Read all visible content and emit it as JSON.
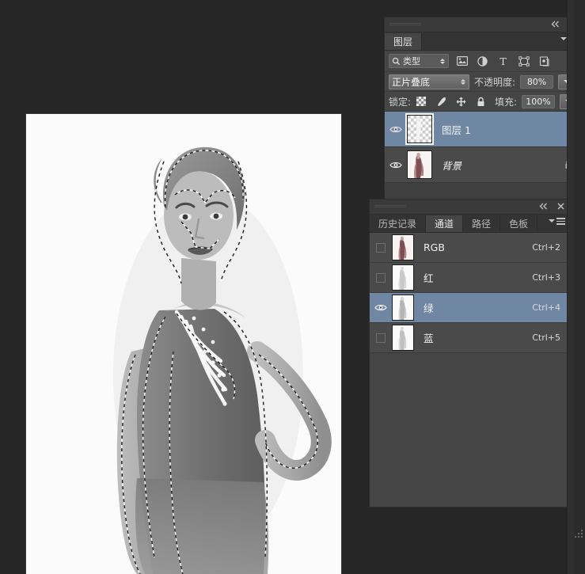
{
  "workspace": {
    "background_color": "#262626",
    "canvas": {
      "name": "document-canvas",
      "description": "Grayscale fashion photograph of a standing woman with marching-ants selection outline",
      "background_color": "#fbfbfb"
    }
  },
  "layers_panel": {
    "tab_label": "图层",
    "window_buttons": {
      "collapse": "collapse-icon",
      "close": "close-icon"
    },
    "menu_button": "panel-menu-icon",
    "filter": {
      "type_label": "类型",
      "search_icon": "search-icon",
      "icons": [
        {
          "name": "pixel-layer-filter-icon",
          "glyph": "image"
        },
        {
          "name": "adjustment-layer-filter-icon",
          "glyph": "circle"
        },
        {
          "name": "type-layer-filter-icon",
          "glyph": "T"
        },
        {
          "name": "shape-layer-filter-icon",
          "glyph": "shape"
        },
        {
          "name": "smart-object-filter-icon",
          "glyph": "smart"
        }
      ],
      "toggle": "filter-enable-toggle"
    },
    "blend_mode": "正片叠底",
    "opacity_label": "不透明度:",
    "opacity_value": "80%",
    "lock_label": "锁定:",
    "lock_icons": [
      {
        "name": "lock-transparent-pixels-icon"
      },
      {
        "name": "lock-image-pixels-icon"
      },
      {
        "name": "lock-position-icon"
      },
      {
        "name": "lock-all-icon"
      }
    ],
    "fill_label": "填充:",
    "fill_value": "100%",
    "layers": [
      {
        "name": "图层 1",
        "visible": true,
        "selected": true,
        "locked": false,
        "italic": false,
        "thumb": "transparent-layer-thumbnail"
      },
      {
        "name": "背景",
        "visible": true,
        "selected": false,
        "locked": true,
        "italic": true,
        "thumb": "background-layer-thumbnail"
      }
    ]
  },
  "channels_panel": {
    "window_buttons": {
      "collapse": "collapse-icon",
      "close": "close-icon"
    },
    "menu_button": "panel-menu-icon",
    "tabs": [
      {
        "label": "历史记录",
        "active": false
      },
      {
        "label": "通道",
        "active": true
      },
      {
        "label": "路径",
        "active": false
      },
      {
        "label": "色板",
        "active": false
      }
    ],
    "channels": [
      {
        "name": "RGB",
        "shortcut": "Ctrl+2",
        "visible": false,
        "selected": false,
        "thumb": "rgb-composite-thumbnail"
      },
      {
        "name": "红",
        "shortcut": "Ctrl+3",
        "visible": false,
        "selected": false,
        "thumb": "red-channel-thumbnail"
      },
      {
        "name": "绿",
        "shortcut": "Ctrl+4",
        "visible": true,
        "selected": true,
        "thumb": "green-channel-thumbnail"
      },
      {
        "name": "蓝",
        "shortcut": "Ctrl+5",
        "visible": false,
        "selected": false,
        "thumb": "blue-channel-thumbnail"
      }
    ]
  },
  "colors": {
    "panel_bg": "#454545",
    "row_bg": "#4a4a4a",
    "selected_row": "#6f87a3",
    "tabbar_bg": "#333333",
    "text": "#f0f0f0"
  }
}
